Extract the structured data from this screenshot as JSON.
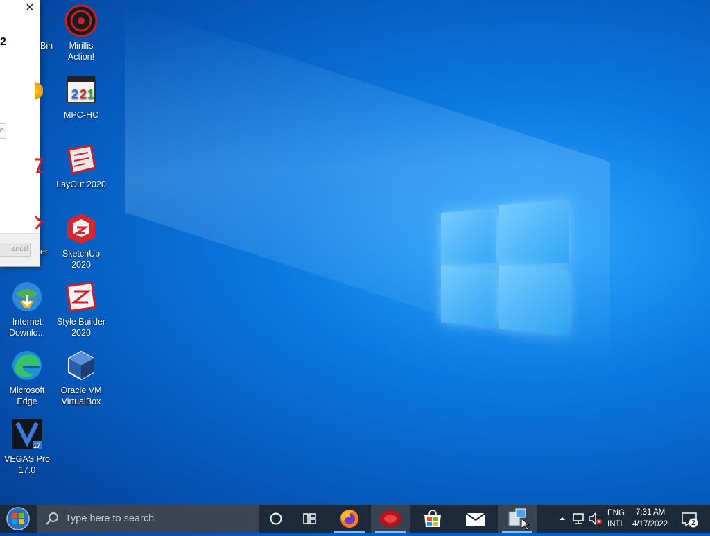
{
  "dialog": {
    "title_fragment": "2",
    "field_fragment": "n",
    "cancel_label": "ancel",
    "close_glyph": "✕"
  },
  "desktop": {
    "partial_labels": [
      "Bin",
      "er"
    ],
    "icons": [
      {
        "line1": "Mirillis",
        "line2": "Action!",
        "icon": "mirillis-action-icon"
      },
      {
        "line1": "MPC-HC",
        "line2": "",
        "icon": "mpc-hc-icon"
      },
      {
        "line1": "LayOut 2020",
        "line2": "",
        "icon": "layout-2020-icon"
      },
      {
        "line1": "SketchUp",
        "line2": "2020",
        "icon": "sketchup-2020-icon"
      },
      {
        "line1": "Internet",
        "line2": "Downlo...",
        "icon": "internet-download-manager-icon"
      },
      {
        "line1": "Style Builder",
        "line2": "2020",
        "icon": "style-builder-2020-icon"
      },
      {
        "line1": "Microsoft",
        "line2": "Edge",
        "icon": "microsoft-edge-icon"
      },
      {
        "line1": "Oracle VM",
        "line2": "VirtualBox",
        "icon": "oracle-vm-virtualbox-icon"
      },
      {
        "line1": "VEGAS Pro",
        "line2": "17.0",
        "icon": "vegas-pro-17-icon"
      }
    ]
  },
  "taskbar": {
    "search_placeholder": "Type here to search",
    "language_line1": "ENG",
    "language_line2": "INTL",
    "time": "7:31 AM",
    "date": "4/17/2022",
    "notification_count": "2"
  },
  "colors": {
    "taskbar": "#1c2a3a",
    "search_box": "#3a4452",
    "desktop_blue": "#0a78e0"
  }
}
